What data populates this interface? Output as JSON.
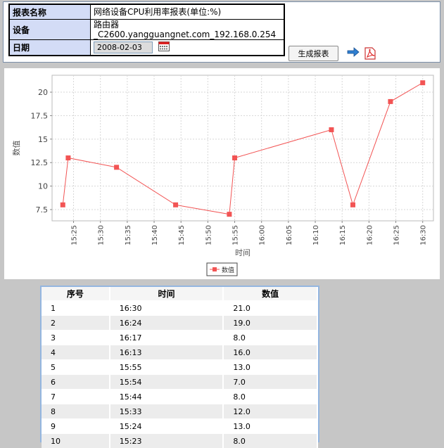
{
  "header": {
    "report_name_label": "报表名称",
    "report_name_value": "网络设备CPU利用率报表(单位:%)",
    "device_label": "设备",
    "device_line1": "路由器",
    "device_line2": "_C2600.yangguangnet.com_192.168.0.254",
    "date_label": "日期",
    "date_value": "2008-02-03",
    "generate_button": "生成报表",
    "icons": {
      "calendar": "calendar-icon",
      "go": "arrow-right-icon",
      "pdf": "pdf-icon"
    }
  },
  "chart_data": {
    "type": "line",
    "xlabel": "时间",
    "ylabel": "数值",
    "x_ticks": [
      "15:25",
      "15:30",
      "15:35",
      "15:40",
      "15:45",
      "15:50",
      "15:55",
      "16:00",
      "16:05",
      "16:10",
      "16:15",
      "16:20",
      "16:25",
      "16:30"
    ],
    "xlim": [
      "15:21",
      "16:32"
    ],
    "y_ticks": [
      7.5,
      10,
      12.5,
      15,
      17.5,
      20
    ],
    "ylim": [
      6.3,
      21.8
    ],
    "grid": true,
    "legend_position": "bottom-center",
    "series": [
      {
        "name": "数值",
        "color": "#f25454",
        "x": [
          "15:23",
          "15:24",
          "15:33",
          "15:44",
          "15:54",
          "15:55",
          "16:13",
          "16:17",
          "16:24",
          "16:30"
        ],
        "values": [
          8.0,
          13.0,
          12.0,
          8.0,
          7.0,
          13.0,
          16.0,
          8.0,
          19.0,
          21.0
        ]
      }
    ]
  },
  "table": {
    "headers": [
      "序号",
      "时间",
      "数值"
    ],
    "rows": [
      [
        "1",
        "16:30",
        "21.0"
      ],
      [
        "2",
        "16:24",
        "19.0"
      ],
      [
        "3",
        "16:17",
        "8.0"
      ],
      [
        "4",
        "16:13",
        "16.0"
      ],
      [
        "5",
        "15:55",
        "13.0"
      ],
      [
        "6",
        "15:54",
        "7.0"
      ],
      [
        "7",
        "15:44",
        "8.0"
      ],
      [
        "8",
        "15:33",
        "12.0"
      ],
      [
        "9",
        "15:24",
        "13.0"
      ],
      [
        "10",
        "15:23",
        "8.0"
      ]
    ]
  }
}
